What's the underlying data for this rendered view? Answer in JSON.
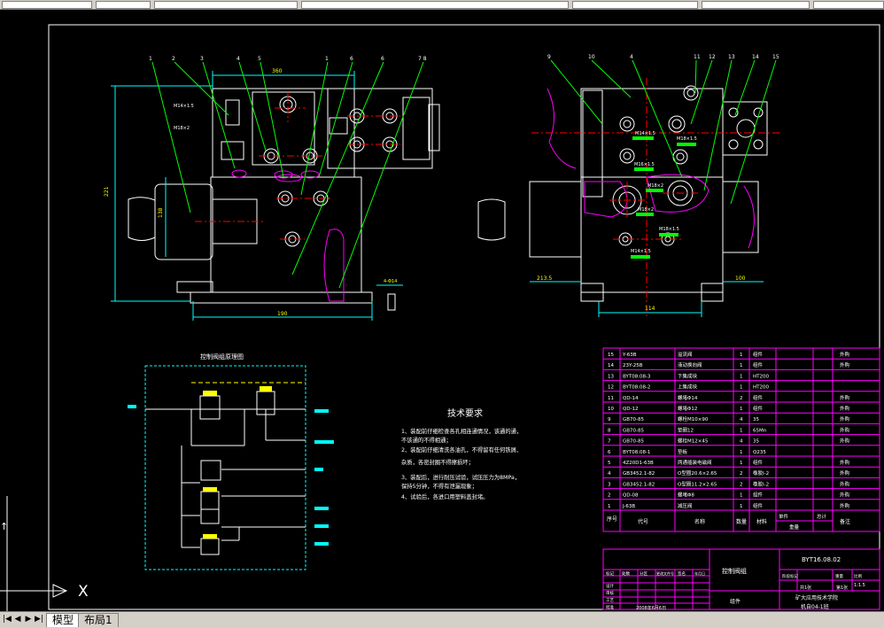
{
  "colors": {
    "bg": "#000000",
    "frame": "#ffffff",
    "leader": "#00ff00",
    "dim": "#00ffff",
    "outline": "#ffffff",
    "accent": "#ff00ff",
    "red": "#ff0000",
    "yellow": "#ffff00"
  },
  "tabs": [
    "模型",
    "布局1"
  ],
  "ucs_label": "X",
  "drawing": {
    "schematic_title": "控制阀组原理图",
    "tech_title": "技术要求",
    "tech_lines": [
      "1、装配前仔细检查各孔相连通情况，该通的通，",
      "   不该通的不得相通；",
      "2、装配前仔细清洗各油孔，不得留有任何铁屑、",
      "   杂质，各密封圈不得擦损坏；",
      "3、装配后，进行耐压试验，试压压力为8MPa，",
      "   保持5分钟，不得有泄漏现象；",
      "4、试验后，各进口用塑料盖封堵。"
    ],
    "dims": {
      "d360": "360",
      "d221": "221",
      "d190": "190",
      "d138": "138",
      "d4M14": "4-Φ14",
      "d2135": "213.5",
      "d100": "100",
      "d114": "114"
    },
    "thread_labels": [
      "M14×1.5",
      "M18×2",
      "M14×1.5",
      "M16×1.5",
      "M18×1.5",
      "M18×2",
      "M18×2",
      "M18×1.5",
      "M14×1.5"
    ],
    "balloons_left": [
      "1",
      "2",
      "3",
      "4",
      "5",
      "1",
      "6",
      "6",
      "7 8"
    ],
    "balloons_right": [
      "9",
      "10",
      "4",
      "11",
      "12",
      "13",
      "14",
      "15"
    ]
  },
  "bom": {
    "rows": [
      {
        "no": "15",
        "code": "Y-63B",
        "name": "溢流阀",
        "qty": "1",
        "mat": "组件",
        "note": "外购"
      },
      {
        "no": "14",
        "code": "23Y-25B",
        "name": "液动换向阀",
        "qty": "1",
        "mat": "组件",
        "note": "外购"
      },
      {
        "no": "13",
        "code": "BYT08.08-3",
        "name": "下集成块",
        "qty": "1",
        "mat": "HT200",
        "note": ""
      },
      {
        "no": "12",
        "code": "BYT08.08-2",
        "name": "上集成块",
        "qty": "1",
        "mat": "HT200",
        "note": ""
      },
      {
        "no": "11",
        "code": "QD-14",
        "name": "螺堵Φ14",
        "qty": "2",
        "mat": "组件",
        "note": "外购"
      },
      {
        "no": "10",
        "code": "QD-12",
        "name": "螺堵Φ12",
        "qty": "1",
        "mat": "组件",
        "note": "外购"
      },
      {
        "no": "9",
        "code": "GB70-85",
        "name": "螺栓M10×90",
        "qty": "4",
        "mat": "35",
        "note": "外购"
      },
      {
        "no": "8",
        "code": "GB70-85",
        "name": "垫圈12",
        "qty": "1",
        "mat": "65Mn",
        "note": "外购"
      },
      {
        "no": "7",
        "code": "GB70-85",
        "name": "螺栓M12×45",
        "qty": "4",
        "mat": "35",
        "note": "外购"
      },
      {
        "no": "6",
        "code": "BYT08.08-1",
        "name": "垫板",
        "qty": "1",
        "mat": "Q235",
        "note": ""
      },
      {
        "no": "5",
        "code": "4Z20D1-63B",
        "name": "两通插装电磁阀",
        "qty": "1",
        "mat": "组件",
        "note": "外购"
      },
      {
        "no": "4",
        "code": "GB3452.1-82",
        "name": "O型圈20.6×2.65",
        "qty": "2",
        "mat": "橡胶I-2",
        "note": "外购"
      },
      {
        "no": "3",
        "code": "GB3452.1-82",
        "name": "O型圈11.2×2.65",
        "qty": "2",
        "mat": "橡胶I-2",
        "note": "外购"
      },
      {
        "no": "2",
        "code": "QD-08",
        "name": "螺堵Φ8",
        "qty": "1",
        "mat": "组件",
        "note": "外购"
      },
      {
        "no": "1",
        "code": "J-63B",
        "name": "减压阀",
        "qty": "1",
        "mat": "组件",
        "note": "外购"
      }
    ],
    "header": {
      "no": "序号",
      "code": "代号",
      "name": "名称",
      "qty": "数量",
      "mat": "材料",
      "single": "单件",
      "total": "总计",
      "weight": "重量",
      "note": "备注"
    }
  },
  "title_block": {
    "name": "控制阀组",
    "drawing_no": "BYT16.08.02",
    "material": "组件",
    "scale": "1:1.5",
    "sheet": "共1张",
    "sheet_no": "第1张",
    "school": "矿大应用技术学院",
    "class": "机自04-1班",
    "date": "2008年6月6日",
    "row_labels": [
      "标记",
      "处数",
      "分区",
      "更改文件号",
      "签名",
      "年月日"
    ],
    "sign_labels": [
      "设计",
      "审核",
      "工艺",
      "批准"
    ],
    "meta_labels": [
      "阶段标记",
      "重量",
      "比例"
    ]
  }
}
